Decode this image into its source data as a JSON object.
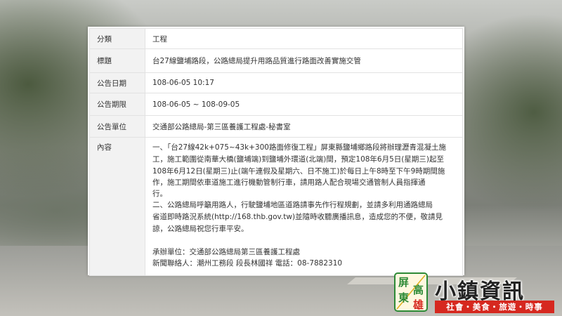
{
  "details": {
    "rows": [
      {
        "label": "分類",
        "value": "工程"
      },
      {
        "label": "標題",
        "value": "台27線鹽埔路段，公路總局提升用路品質進行路面改善實施交管"
      },
      {
        "label": "公告日期",
        "value": "108-06-05 10:17"
      },
      {
        "label": "公告期限",
        "value": "108-06-05 ~ 108-09-05"
      },
      {
        "label": "公告單位",
        "value": "交通部公路總局-第三區養護工程處-秘書室"
      }
    ],
    "content": {
      "label": "內容",
      "lines_p1": [
        "一、「台27線42k+075~43k+300路面修復工程」屏東縣鹽埔鄉路段將辦理瀝青混凝土施",
        "工，施工範圍從南華大橋(鹽埔端)到鹽埔外環道(北端)間，預定108年6月5日(星期三)起至",
        "108年6月12日(星期三)止(端午連假及星期六、日不施工)於每日上午8時至下午9時期間施",
        "作，施工期間依車道施工進行機動管制行車，請用路人配合現場交通管制人員指揮通",
        "行。"
      ],
      "lines_p2": [
        "二、公路總局呼籲用路人，行駛鹽埔地區道路請事先作行程規劃，並請多利用通路總局",
        "省道即時路況系統(http://168.thb.gov.tw)並隨時收聽廣播訊息，造成您的不便，敬請見",
        "諒，公路總局祝您行車平安。"
      ],
      "contact_unit": "承辦單位：交通部公路總局第三區養護工程處",
      "contact_person": "新聞聯絡人：潮州工務段 段長林國祥 電話：08-7882310"
    }
  },
  "watermark": {
    "badge_chars": [
      "屏",
      "高",
      "東",
      "雄"
    ],
    "title": "小鎮資訊",
    "subtitle": "社會・美食・旅遊・時事",
    "colors": {
      "red": "#d6281f",
      "green": "#2d8a36",
      "dark": "#222222"
    }
  }
}
